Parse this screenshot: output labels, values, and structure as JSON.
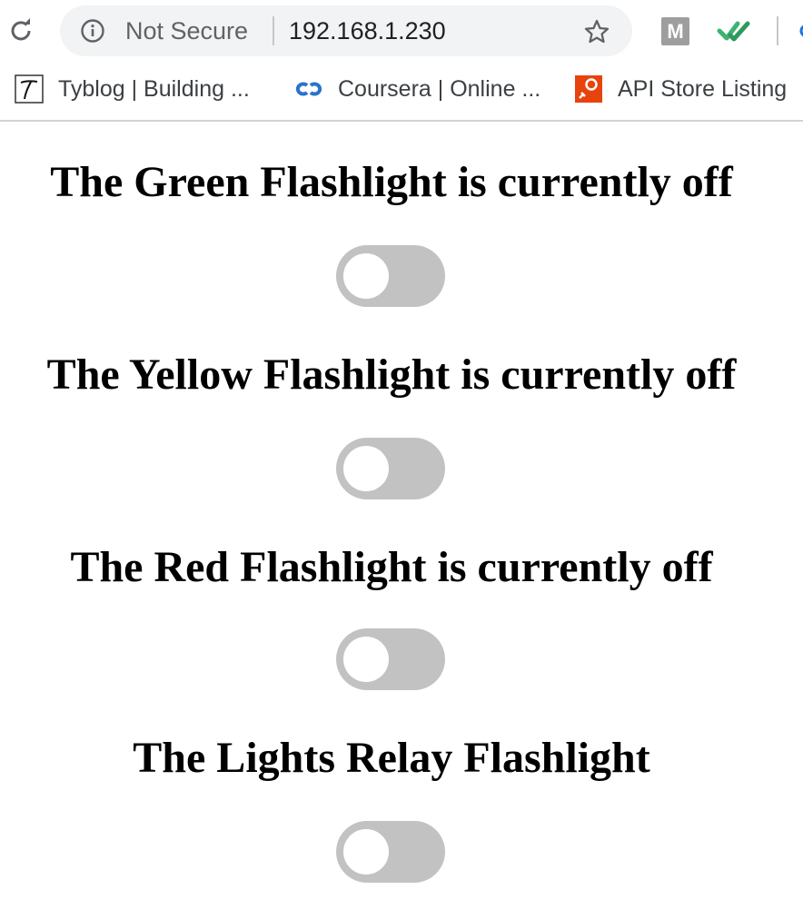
{
  "browser": {
    "security_text": "Not Secure",
    "url": "192.168.1.230",
    "extension_m_label": "M"
  },
  "bookmarks": [
    {
      "label": "Tyblog | Building ...",
      "icon": "tyblog-favicon"
    },
    {
      "label": "Coursera | Online ...",
      "icon": "coursera-favicon"
    },
    {
      "label": "API Store Listing",
      "icon": "api-store-favicon"
    }
  ],
  "flashlights": [
    {
      "title": "The Green Flashlight is currently off",
      "state": "off"
    },
    {
      "title": "The Yellow Flashlight is currently off",
      "state": "off"
    },
    {
      "title": "The Red Flashlight is currently off",
      "state": "off"
    },
    {
      "title": "The Lights Relay Flashlight",
      "state": "off"
    }
  ],
  "colors": {
    "toggle_off": "#c2c2c2",
    "toggle_knob": "#ffffff",
    "omnibox_bg": "#f1f3f4",
    "coursera_blue": "#2a73cc",
    "checkmark_green": "#3cb371",
    "api_store_orange": "#e8430c"
  }
}
